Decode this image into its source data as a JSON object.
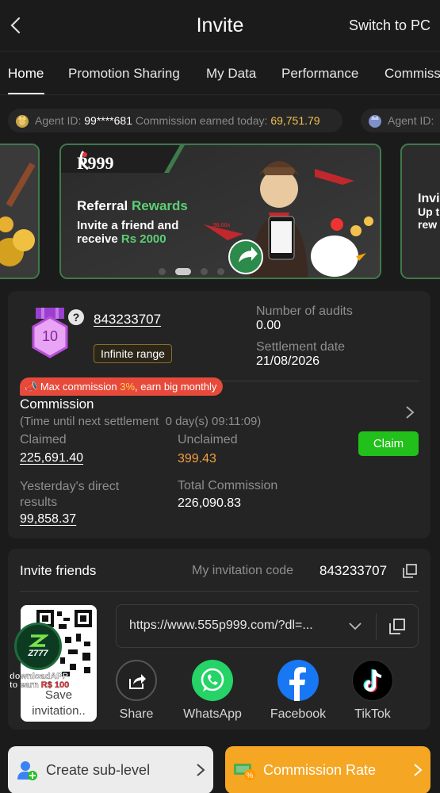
{
  "header": {
    "title": "Invite",
    "switch_label": "Switch to PC"
  },
  "tabs": [
    "Home",
    "Promotion Sharing",
    "My Data",
    "Performance",
    "Commiss"
  ],
  "marquee": {
    "label": "Agent ID:",
    "agent_id": "99****681",
    "earned_label": "Commission earned today:",
    "earned_value": "69,751.79",
    "second_label": "Agent ID:"
  },
  "banner": {
    "brand": "P999",
    "headline_a": "Referral",
    "headline_b": "Rewards",
    "line1": "Invite a friend and",
    "line2a": "receive",
    "line2b": "Rs 2000",
    "right_peek_1": "Invi",
    "right_peek_2": "Up t",
    "right_peek_3": "rew",
    "phone_value": "56.00x"
  },
  "agent": {
    "level": "10",
    "help": "?",
    "id": "843233707",
    "range": "Infinite range",
    "audits_label": "Number of audits",
    "audits_value": "0.00",
    "settle_label": "Settlement date",
    "settle_value": "21/08/2026"
  },
  "commission": {
    "promo_a": "Max commission",
    "promo_pct": "3%",
    "promo_b": ", earn big monthly",
    "title": "Commission",
    "timer": "(Time until next settlement  0 day(s) 09:11:09)",
    "claimed_label": "Claimed",
    "claimed_value": "225,691.40",
    "unclaimed_label": "Unclaimed",
    "unclaimed_value": "399.43",
    "claim_btn": "Claim",
    "yesterday_label_1": "Yesterday's direct",
    "yesterday_label_2": "results",
    "yesterday_value": "99,858.37",
    "total_label": "Total Commission",
    "total_value": "226,090.83"
  },
  "invite": {
    "title": "Invite friends",
    "code_label": "My invitation code",
    "code": "843233707",
    "qr_badge": "Z777",
    "qr_dl": "downloadAPP",
    "qr_earn_a": "to earn",
    "qr_earn_b": "R$ 100",
    "qr_save_1": "Save",
    "qr_save_2": "invitation..",
    "link": "https://www.555p999.com/?dl=...",
    "share": [
      "Share",
      "WhatsApp",
      "Facebook",
      "TikTok"
    ]
  },
  "bottom": {
    "left": "Create sub-level",
    "right": "Commission Rate"
  },
  "colors": {
    "accent_green": "#22c01a",
    "gold": "#f2c14e",
    "orange": "#f5a623",
    "unclaimed": "#f0a040"
  }
}
